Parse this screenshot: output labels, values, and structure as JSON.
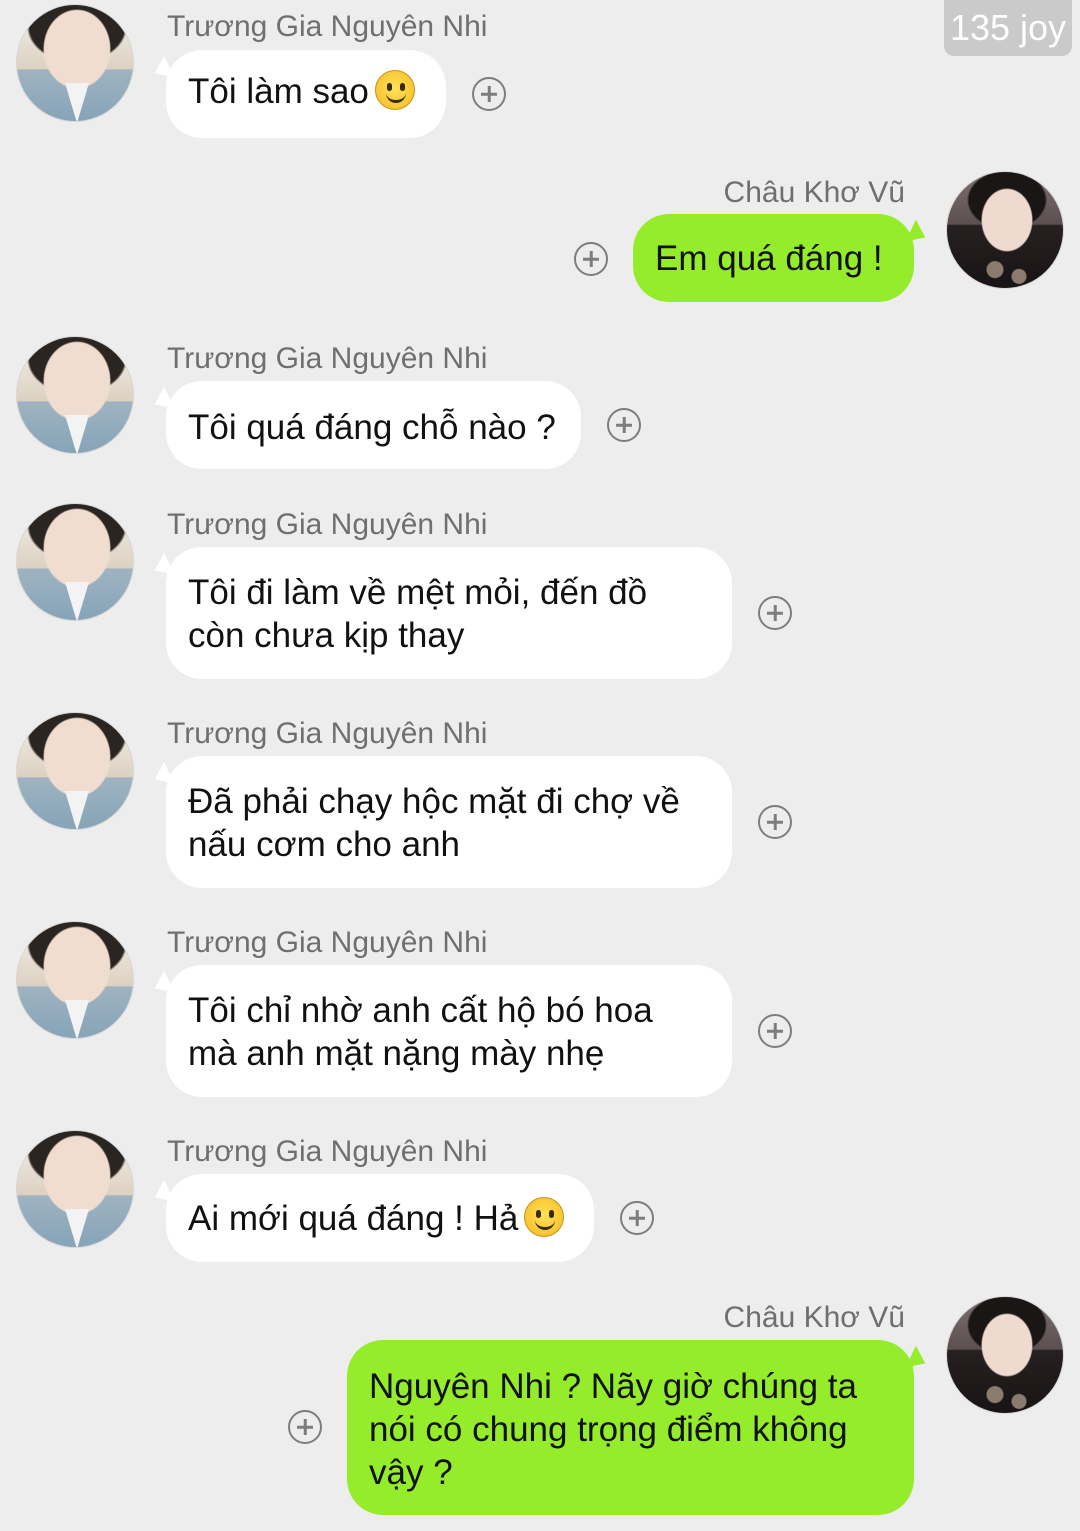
{
  "watermark": "135 joy",
  "messages": [
    {
      "sender": "Trương Gia Nguyên Nhi",
      "text": "Tôi làm sao",
      "emoji": "smiley",
      "side": "left"
    },
    {
      "sender": "Châu Khơ Vũ",
      "text": "Em quá đáng !",
      "side": "right"
    },
    {
      "sender": "Trương Gia Nguyên Nhi",
      "text": "Tôi quá đáng chỗ nào ?",
      "side": "left"
    },
    {
      "sender": "Trương Gia Nguyên Nhi",
      "text": "Tôi đi làm về mệt mỏi, đến đồ\ncòn chưa kịp thay",
      "side": "left"
    },
    {
      "sender": "Trương Gia Nguyên Nhi",
      "text": "Đã phải chạy hộc mặt đi chợ về\nnấu cơm cho anh",
      "side": "left"
    },
    {
      "sender": "Trương Gia Nguyên Nhi",
      "text": "Tôi chỉ nhờ anh cất hộ bó hoa\nmà anh mặt nặng mày nhẹ",
      "side": "left"
    },
    {
      "sender": "Trương Gia Nguyên Nhi",
      "text": "Ai mới quá đáng ! Hả",
      "emoji": "smiley",
      "side": "left"
    },
    {
      "sender": "Châu Khơ Vũ",
      "text": "Nguyên Nhi ? Nãy giờ chúng ta\nnói có chung trọng điểm không\nvậy ?",
      "side": "right"
    }
  ]
}
